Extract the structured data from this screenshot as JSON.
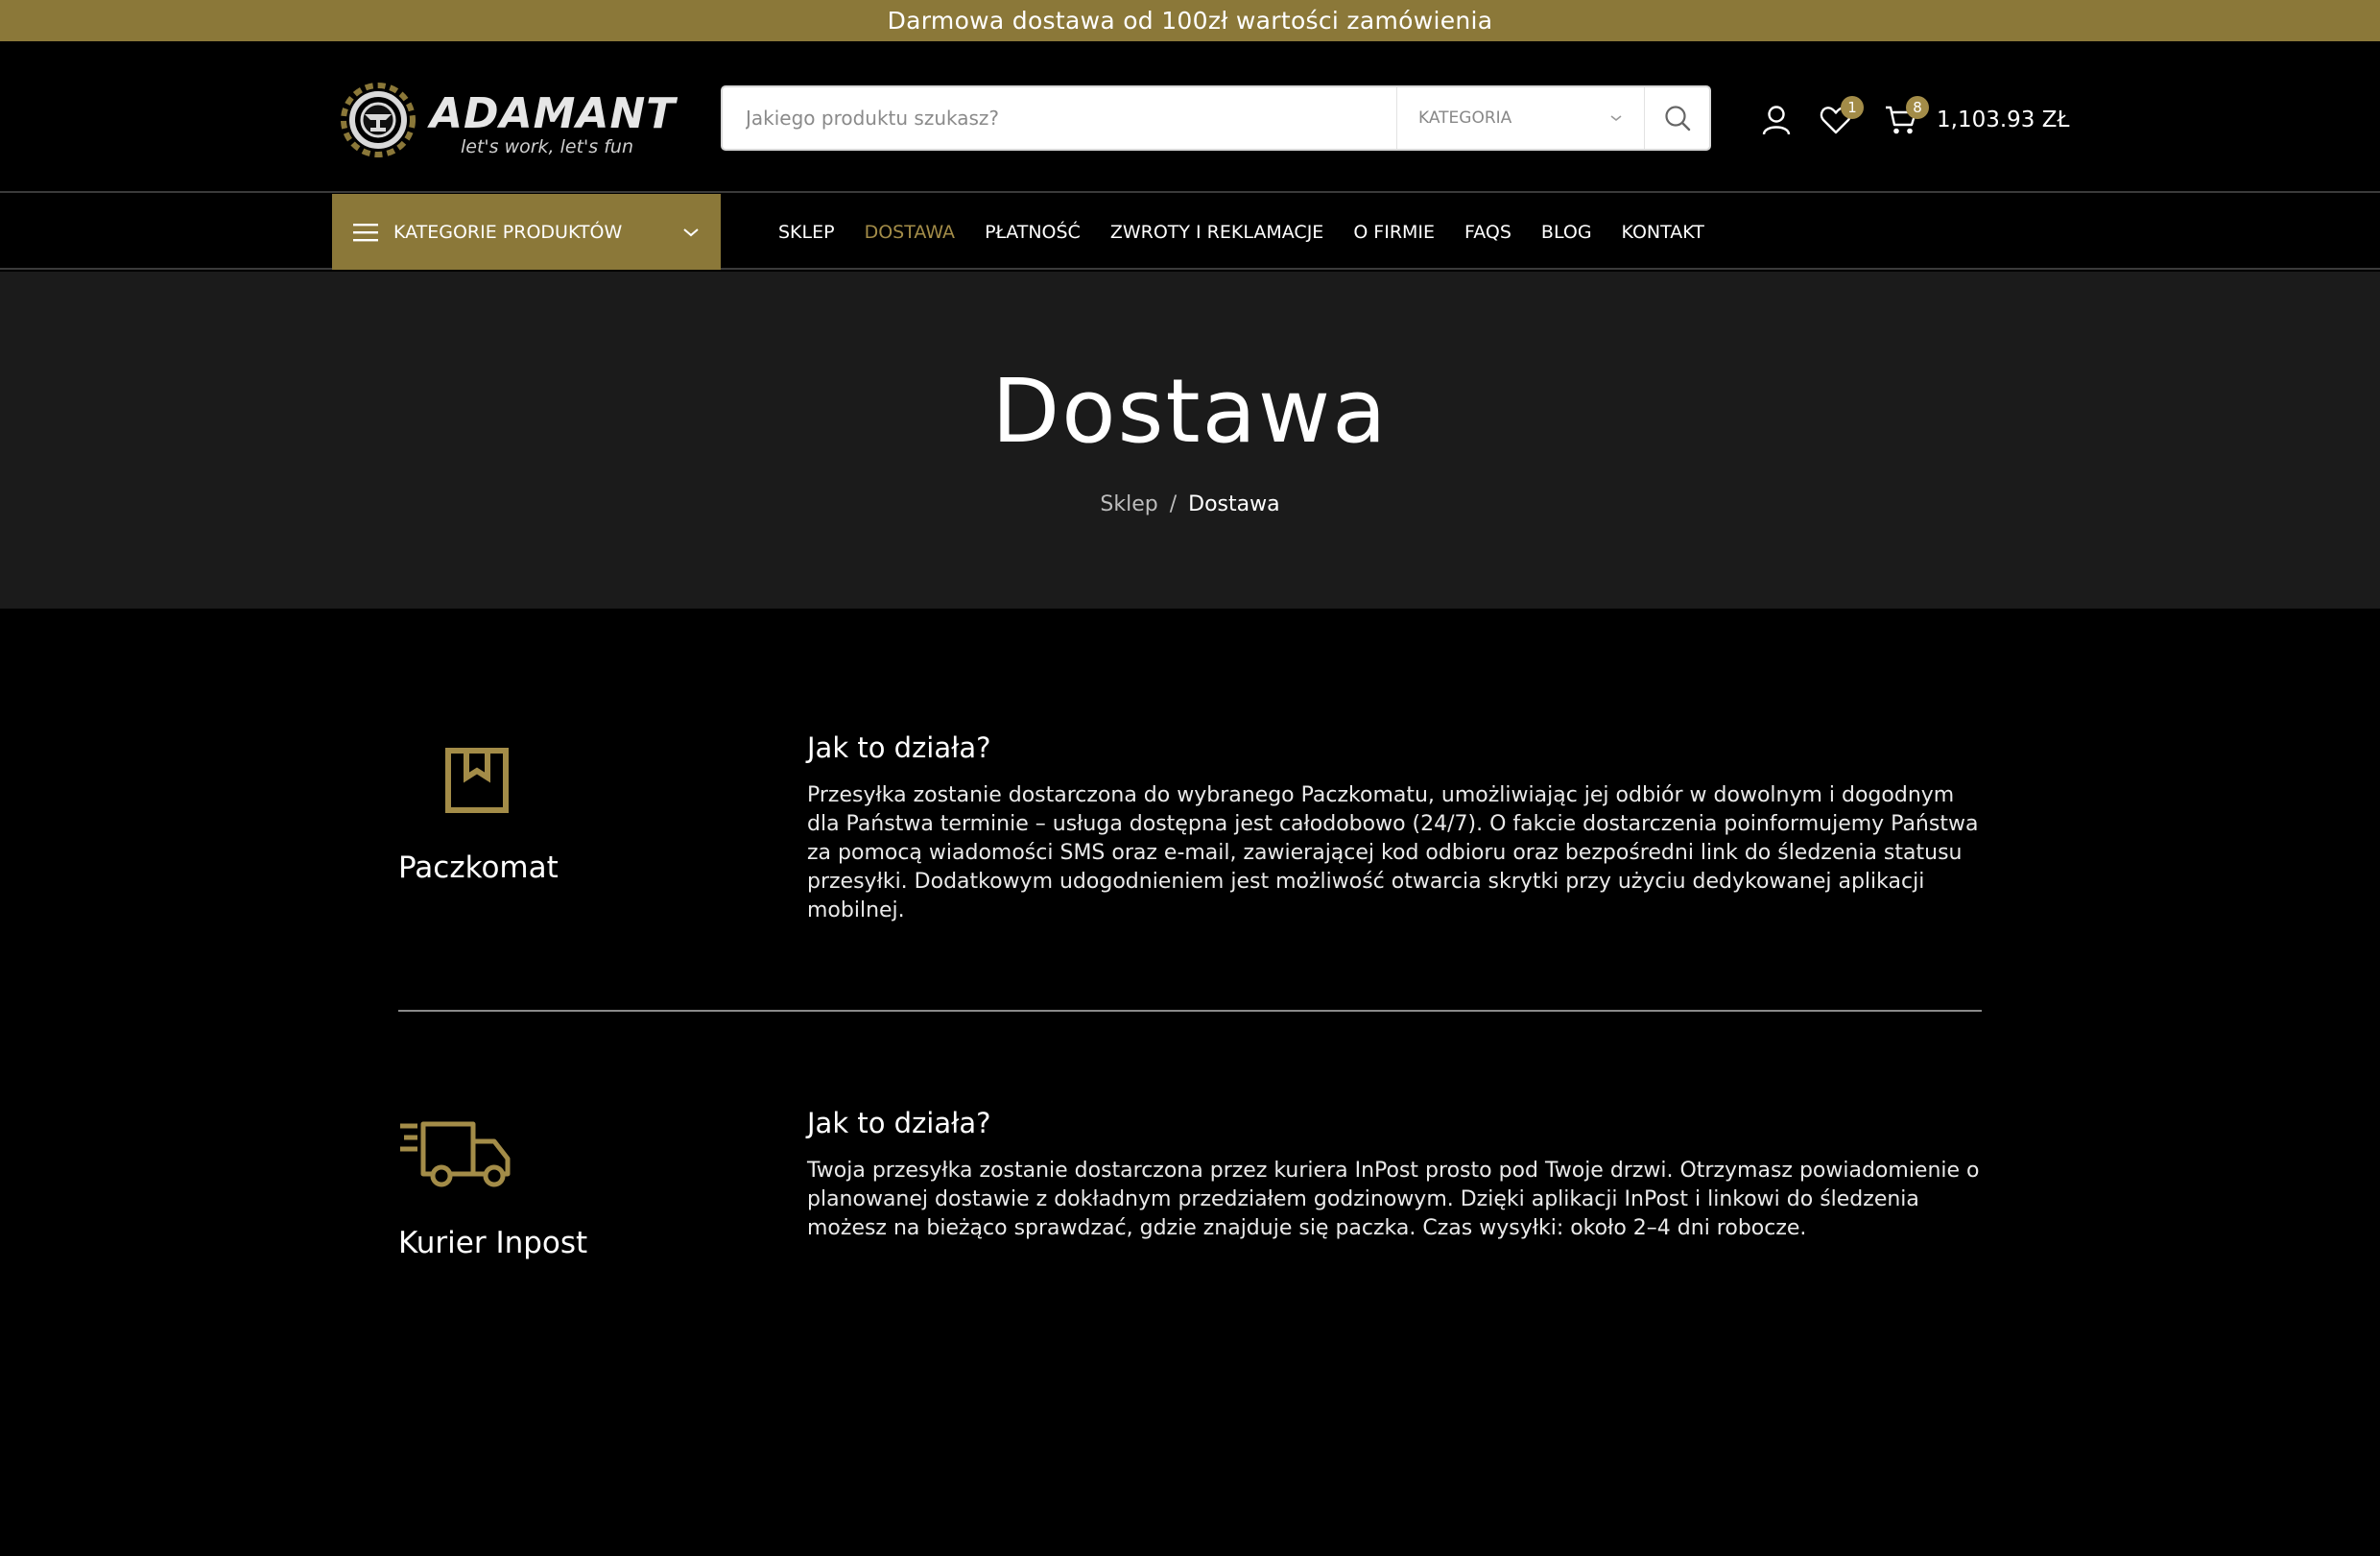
{
  "topbar": {
    "text": "Darmowa dostawa od 100zł wartości zamówienia"
  },
  "header": {
    "logo": {
      "brand": "ADAMANT",
      "tagline": "let's work, let's fun"
    },
    "search": {
      "placeholder": "Jakiego produktu szukasz?",
      "category": "KATEGORIA"
    },
    "wishlist_count": "1",
    "cart_count": "8",
    "cart_total": "1,103.93 ZŁ"
  },
  "nav": {
    "categories_label": "KATEGORIE PRODUKTÓW",
    "items": [
      "SKLEP",
      "DOSTAWA",
      "PŁATNOŚĆ",
      "ZWROTY I REKLAMACJE",
      "O FIRMIE",
      "FAQS",
      "BLOG",
      "KONTAKT"
    ]
  },
  "hero": {
    "title": "Dostawa",
    "breadcrumb": {
      "home": "Sklep",
      "separator": "/",
      "current": "Dostawa"
    }
  },
  "methods": [
    {
      "name": "Paczkomat",
      "heading": "Jak to działa?",
      "description": "Przesyłka zostanie dostarczona do wybranego Paczkomatu, umożliwiając jej odbiór w dowolnym i dogodnym dla Państwa terminie – usługa dostępna jest całodobowo (24/7). O fakcie dostarczenia poinformujemy Państwa za pomocą wiadomości SMS oraz e-mail, zawierającej kod odbioru oraz bezpośredni link do śledzenia statusu przesyłki. Dodatkowym udogodnieniem jest możliwość otwarcia skrytki przy użyciu dedykowanej aplikacji mobilnej."
    },
    {
      "name": "Kurier Inpost",
      "heading": "Jak to działa?",
      "description": "Twoja przesyłka zostanie dostarczona przez kuriera InPost prosto pod Twoje drzwi. Otrzymasz powiadomienie o planowanej dostawie z dokładnym przedziałem godzinowym. Dzięki aplikacji InPost i linkowi do śledzenia możesz na bieżąco sprawdzać, gdzie znajduje się paczka. Czas wysyłki: około 2–4 dni robocze."
    }
  ],
  "colors": {
    "accent": "#8b7839",
    "accent_text": "#a38c48",
    "hero_bg": "#1b1b1b",
    "page_bg": "#000000"
  }
}
